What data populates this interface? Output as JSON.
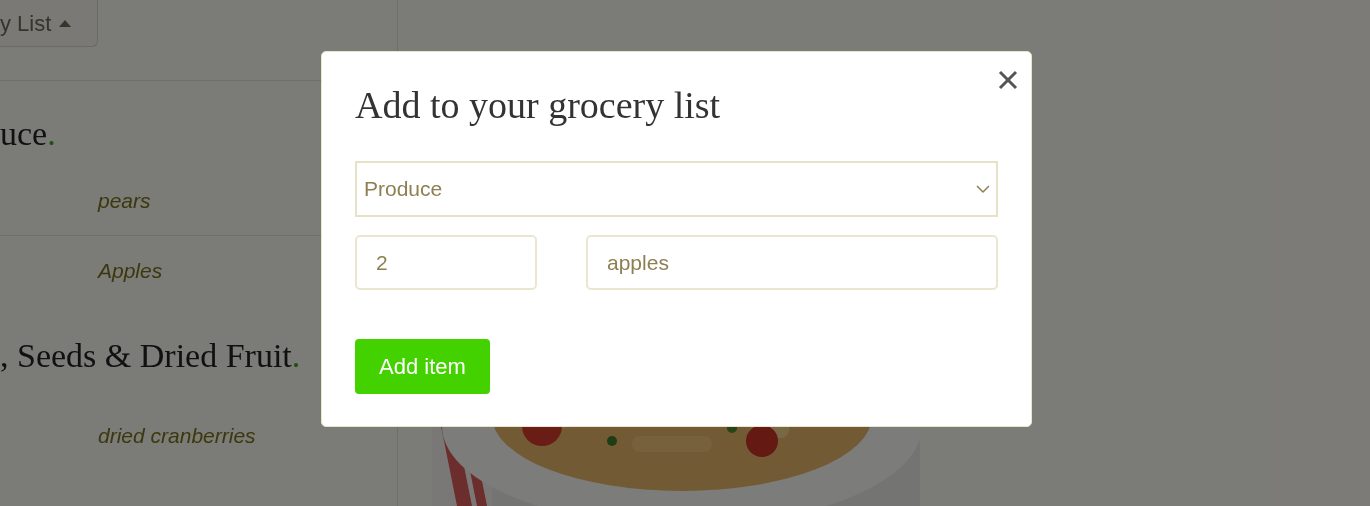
{
  "page": {
    "list_button": {
      "label": "y List"
    },
    "sections": [
      {
        "title": "uce",
        "accent": ".",
        "items": [
          {
            "name": "pears",
            "divider": true
          },
          {
            "name": "Apples",
            "divider": false
          }
        ]
      },
      {
        "title": ", Seeds & Dried Fruit",
        "accent": ".",
        "items": [
          {
            "name": "dried cranberries",
            "divider": false
          }
        ]
      }
    ]
  },
  "dialog": {
    "title": "Add to your grocery list",
    "category": {
      "value": "Produce"
    },
    "quantity": {
      "value": "2"
    },
    "item_name": {
      "value": "apples"
    },
    "submit": "Add item"
  }
}
